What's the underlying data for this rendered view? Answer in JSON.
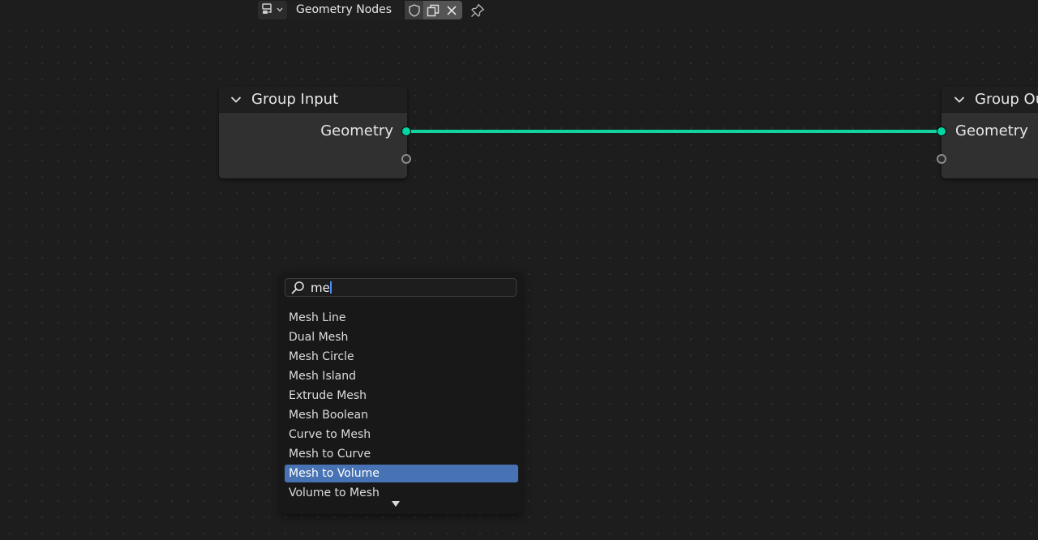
{
  "header": {
    "tree_name": "Geometry Nodes",
    "icons": [
      "node-editor-type-icon",
      "chevron-down-icon",
      "fake-user-shield-icon",
      "duplicate-icon",
      "close-icon",
      "pin-icon"
    ]
  },
  "nodes": {
    "group_input": {
      "title": "Group Input",
      "output_label": "Geometry"
    },
    "group_output": {
      "title": "Group Ou",
      "input_label": "Geometry"
    }
  },
  "colors": {
    "geometry_socket": "#00d6a3",
    "link": "#14d2a0",
    "selection": "#4772b3",
    "background": "#1d1d1d"
  },
  "search": {
    "query": "me",
    "results": [
      "Mesh Line",
      "Dual Mesh",
      "Mesh Circle",
      "Mesh Island",
      "Extrude Mesh",
      "Mesh Boolean",
      "Curve to Mesh",
      "Mesh to Curve",
      "Mesh to Volume",
      "Volume to Mesh"
    ],
    "selected": "Mesh to Volume"
  }
}
